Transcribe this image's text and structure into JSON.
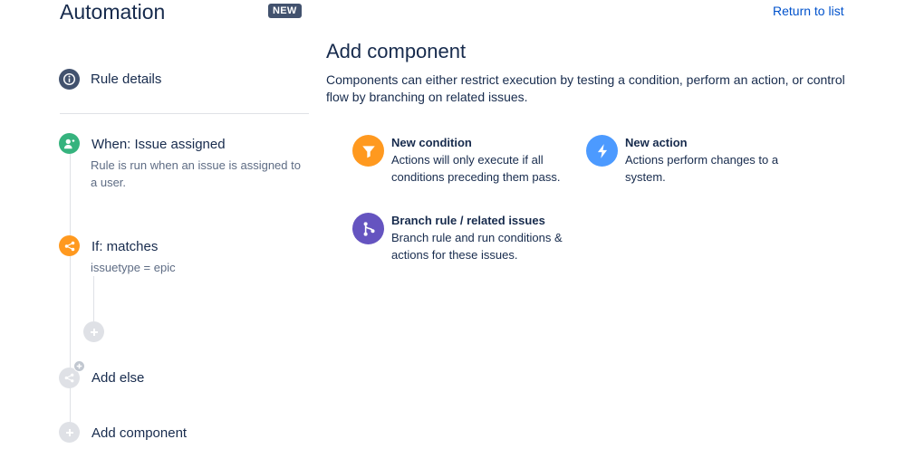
{
  "header": {
    "title": "Automation",
    "badge": "NEW",
    "return_link": "Return to list"
  },
  "sidebar": {
    "rule_details": {
      "label": "Rule details",
      "icon": "info-icon"
    },
    "trigger": {
      "title": "When: Issue assigned",
      "description": "Rule is run when an issue is assigned to a user.",
      "icon": "user-assigned-icon",
      "color": "#36b37e"
    },
    "condition": {
      "title": "If: matches",
      "description": "issuetype = epic",
      "icon": "branch-icon",
      "color": "#ff991f"
    },
    "add_else": {
      "label": "Add else",
      "icon": "branch-icon"
    },
    "add_component": {
      "label": "Add component",
      "icon": "plus-icon"
    }
  },
  "main": {
    "title": "Add component",
    "description": "Components can either restrict execution by testing a condition, perform an action, or control flow by branching on related issues.",
    "options": [
      {
        "title": "New condition",
        "description": "Actions will only execute if all conditions preceding them pass.",
        "icon": "filter-icon",
        "color": "#ff991f"
      },
      {
        "title": "New action",
        "description": "Actions perform changes to a system.",
        "icon": "lightning-icon",
        "color": "#4c9aff"
      },
      {
        "title": "Branch rule / related issues",
        "description": "Branch rule and run conditions & actions for these issues.",
        "icon": "branch-icon",
        "color": "#6554c0"
      }
    ]
  },
  "colors": {
    "link": "#0052cc",
    "text": "#172b4d",
    "muted": "#5e6c84",
    "grey": "#c1c7d0"
  }
}
